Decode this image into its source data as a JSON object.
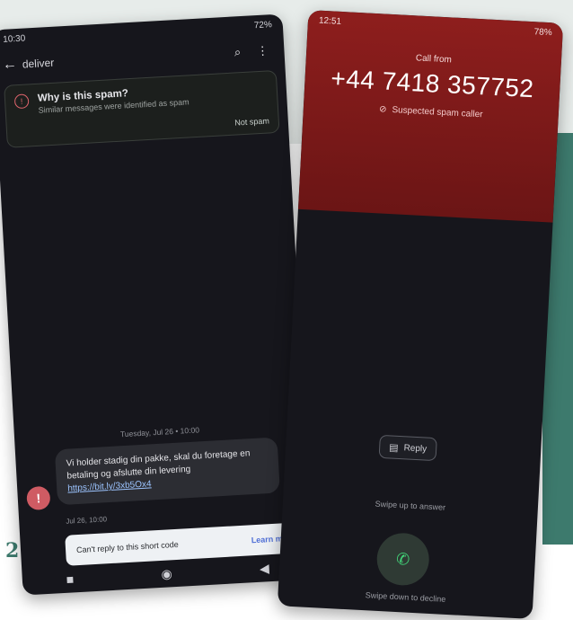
{
  "page_number": "22",
  "left_phone": {
    "status_time": "10:30",
    "status_right": "72%",
    "appbar_title": "deliver",
    "spam_card": {
      "title": "Why is this spam?",
      "subtitle": "Similar messages were identified as spam",
      "action": "Not spam"
    },
    "thread_time": "Tuesday, Jul 26 • 10:00",
    "avatar_letter": "!",
    "message": {
      "text": "Vi holder stadig din pakke, skal du foretage en betaling og afslutte din levering",
      "link": "https://bit.ly/3xb5Ox4",
      "meta": "Jul 26, 10:00"
    },
    "reply_bar": {
      "text": "Can't reply to this short code",
      "action": "Learn more"
    },
    "nav": {
      "recents": "■",
      "home": "◉",
      "back": "◀"
    }
  },
  "right_phone": {
    "status_time": "12:51",
    "status_right": "78%",
    "call_from": "Call from",
    "number": "+44 7418 357752",
    "spam_label": "Suspected spam caller",
    "reply_label": "Reply",
    "swipe_up": "Swipe up to answer",
    "swipe_down": "Swipe down to decline"
  },
  "colors": {
    "accent_teal": "#3d7a6d",
    "call_red": "#8e1e1d",
    "spam_red": "#e0656d",
    "answer_green": "#42d479"
  }
}
